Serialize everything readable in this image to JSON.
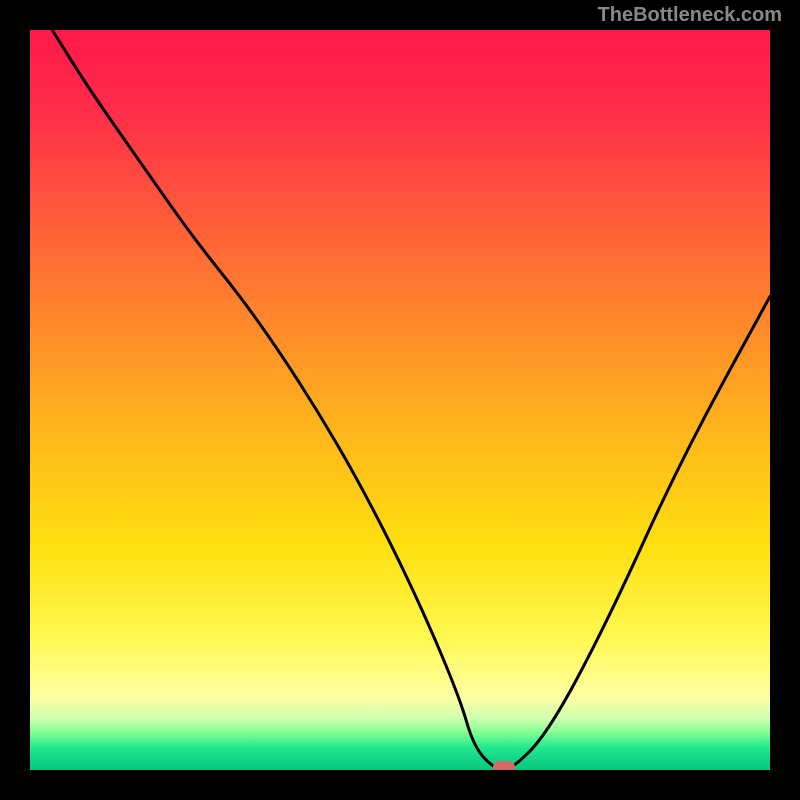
{
  "watermark": "TheBottleneck.com",
  "chart_data": {
    "type": "line",
    "title": "",
    "xlabel": "",
    "ylabel": "",
    "xlim": [
      0,
      100
    ],
    "ylim": [
      0,
      100
    ],
    "series": [
      {
        "name": "bottleneck-curve",
        "x": [
          3,
          8,
          15,
          22,
          30,
          38,
          45,
          52,
          58,
          60,
          63,
          65,
          70,
          78,
          88,
          100
        ],
        "values": [
          100,
          92,
          82,
          72,
          62,
          50,
          38,
          24,
          10,
          3,
          0,
          0,
          5,
          20,
          42,
          64
        ]
      }
    ],
    "marker": {
      "x": 64,
      "y": 0
    }
  },
  "colors": {
    "gradient_top": "#ff1a4a",
    "gradient_mid": "#ffe010",
    "gradient_bottom": "#10d085",
    "curve": "#000000",
    "marker": "#d66a6a",
    "frame": "#000000"
  }
}
